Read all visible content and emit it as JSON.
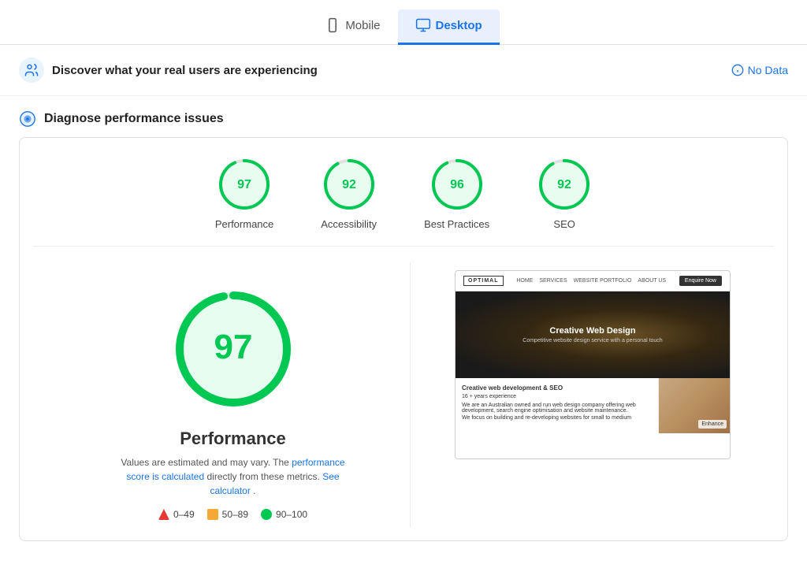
{
  "tabs": [
    {
      "id": "mobile",
      "label": "Mobile",
      "active": false
    },
    {
      "id": "desktop",
      "label": "Desktop",
      "active": true
    }
  ],
  "discover": {
    "title": "Discover what your real users are experiencing",
    "no_data_label": "No Data"
  },
  "diagnose": {
    "title": "Diagnose performance issues"
  },
  "scores": [
    {
      "id": "performance",
      "value": 97,
      "label": "Performance",
      "color": "#00c853"
    },
    {
      "id": "accessibility",
      "value": 92,
      "label": "Accessibility",
      "color": "#00c853"
    },
    {
      "id": "best-practices",
      "value": 96,
      "label": "Best Practices",
      "color": "#00c853"
    },
    {
      "id": "seo",
      "value": 92,
      "label": "SEO",
      "color": "#00c853"
    }
  ],
  "detail": {
    "big_score": 97,
    "big_label": "Performance",
    "description_start": "Values are estimated and may vary. The",
    "description_link1": "performance score is calculated",
    "description_mid": "directly from these metrics.",
    "description_link2": "See calculator",
    "description_end": "."
  },
  "legend": [
    {
      "id": "fail",
      "range": "0–49",
      "color": "#e53935"
    },
    {
      "id": "average",
      "range": "50–89",
      "color": "#f4a835"
    },
    {
      "id": "pass",
      "range": "90–100",
      "color": "#00c853"
    }
  ],
  "preview": {
    "logo": "OPTIMAL",
    "nav": [
      "HOME",
      "SERVICES",
      "WEBSITE PORTFOLIO",
      "ABOUT US"
    ],
    "cta": "Enquire Now",
    "hero_title": "Creative Web Design",
    "hero_sub": "Competitive website design service with a personal touch",
    "content_bold": "Creative web development & SEO",
    "content_line2": "16 + years experience",
    "content_body": "We are an Australian owned and run web design company offering web development, search engine optimisation and website maintenance.",
    "content_body2": "We focus on building and re-developing websites for small to medium",
    "enhance_label": "Enhance"
  }
}
